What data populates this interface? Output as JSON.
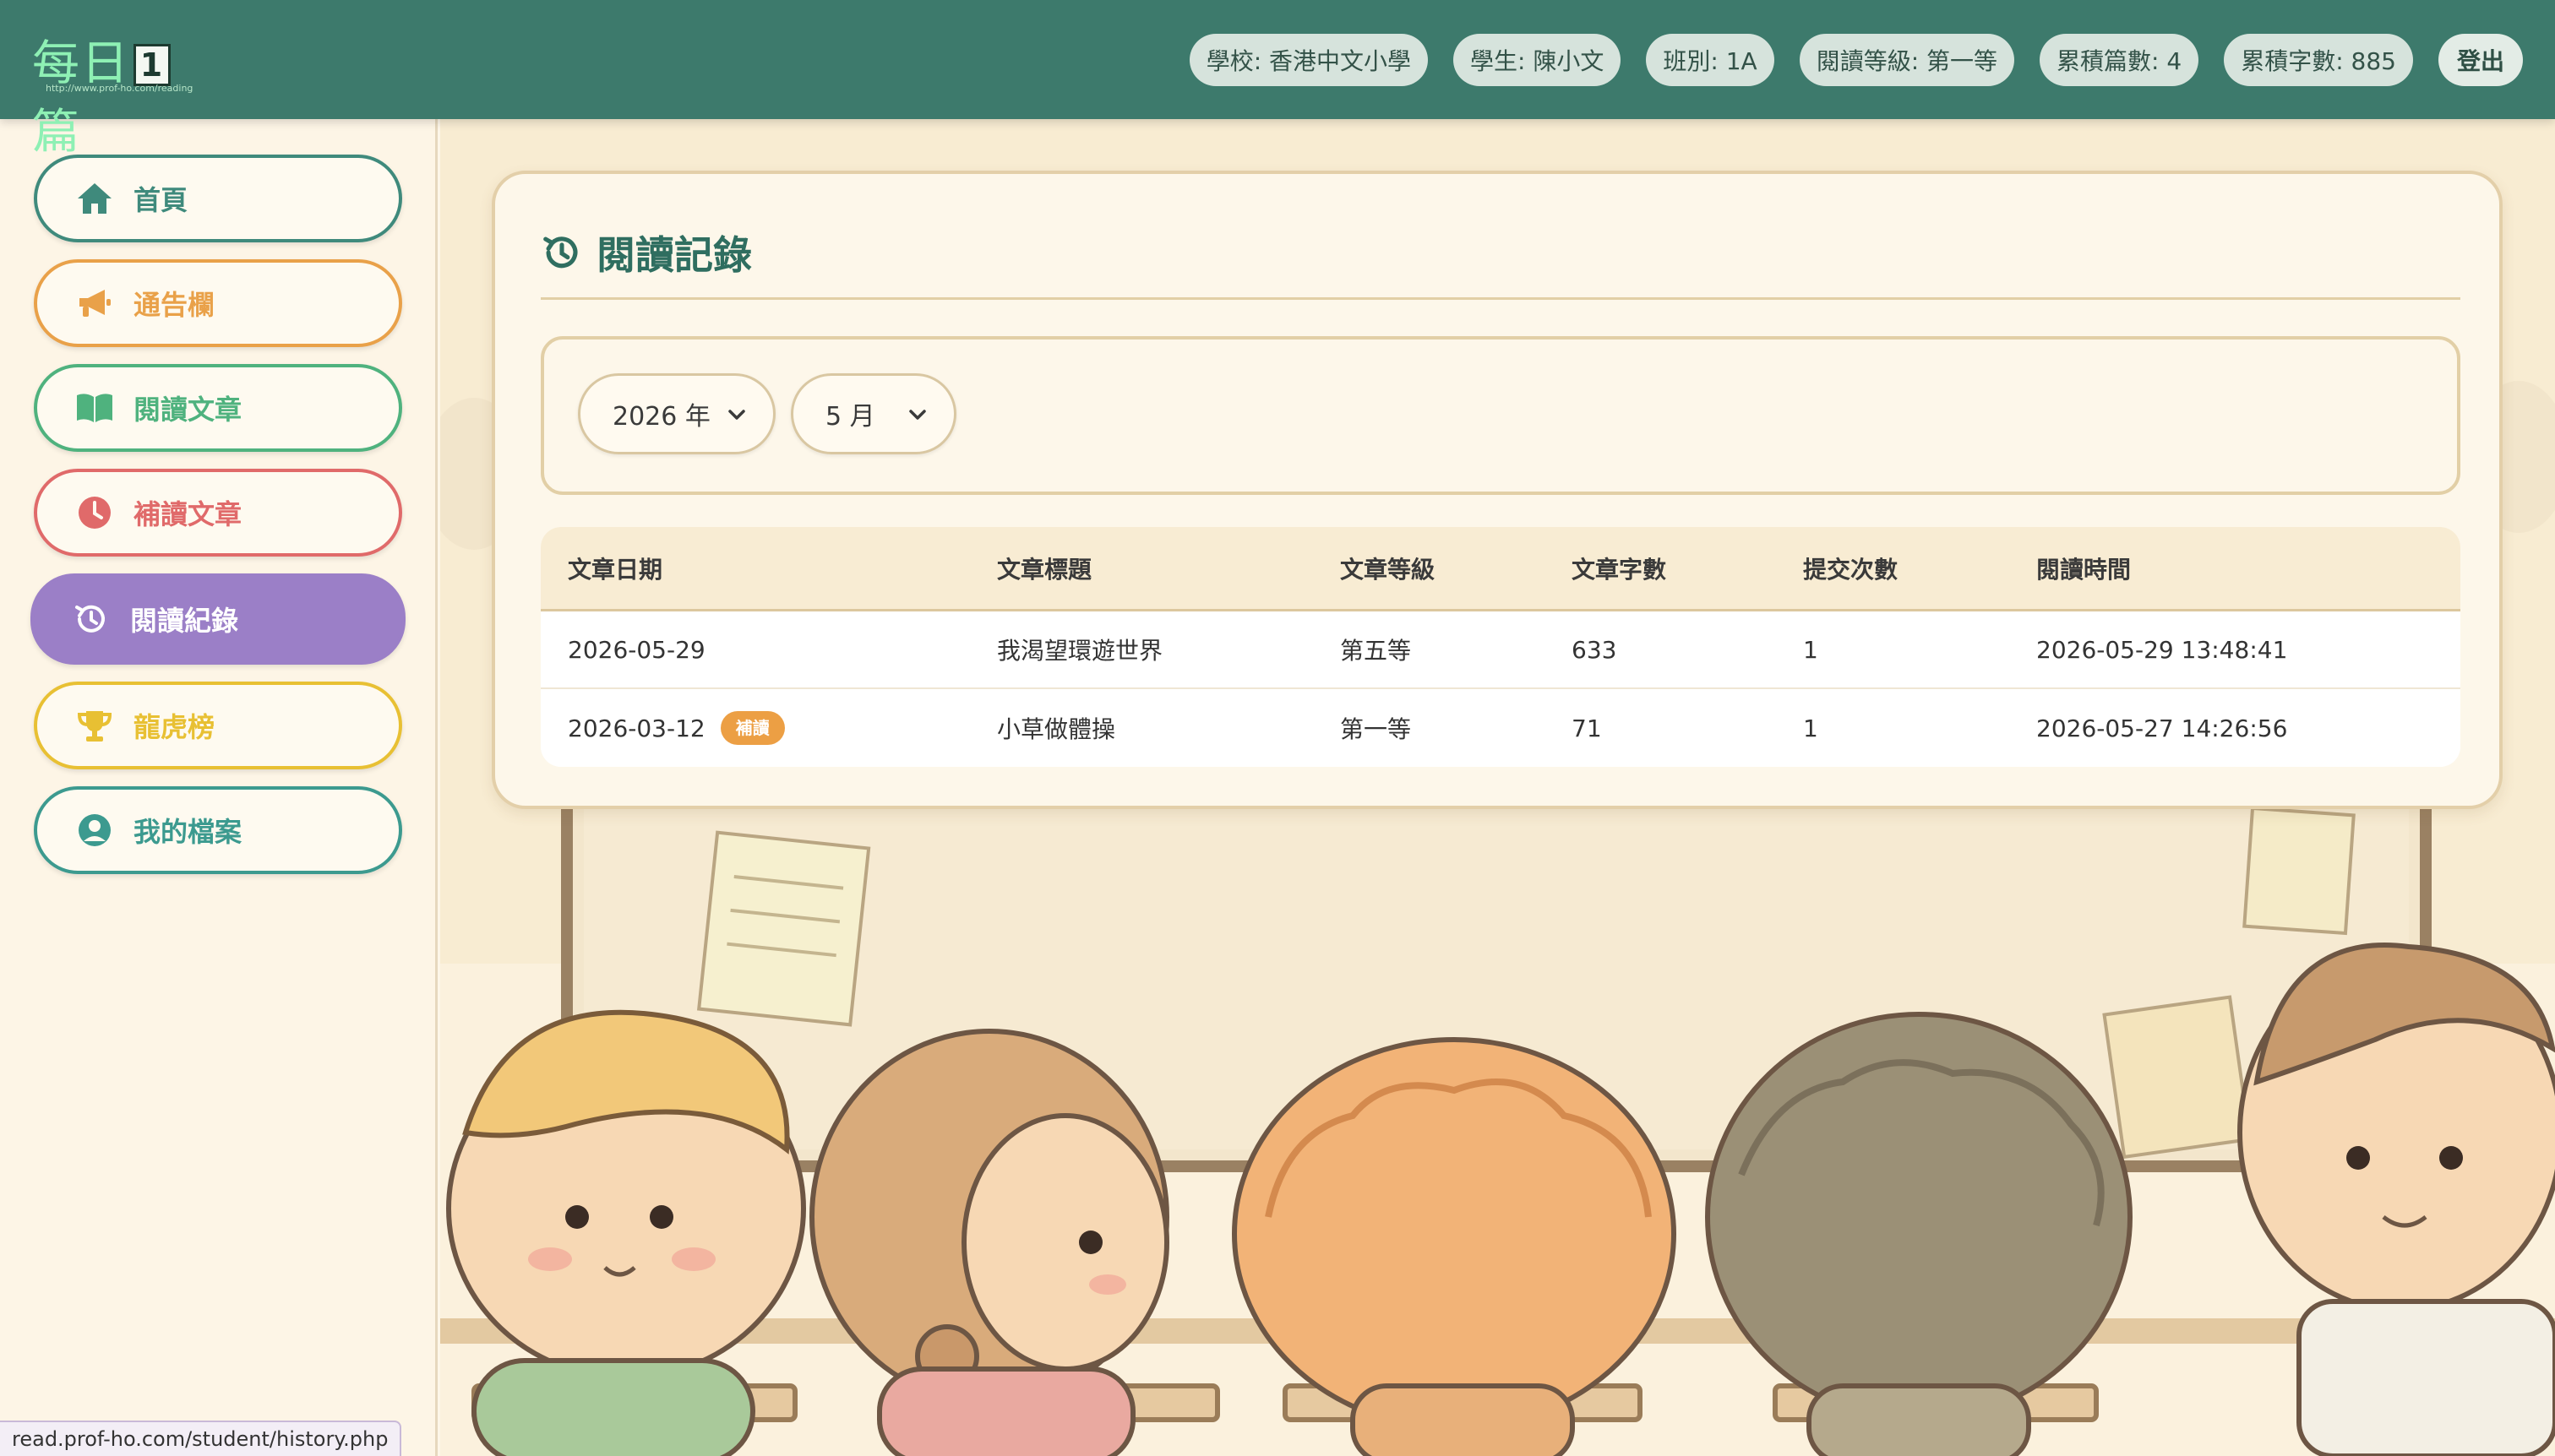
{
  "header": {
    "logo_text_left": "每日",
    "logo_box": "1",
    "logo_text_right": "篇",
    "logo_url": "http://www.prof-ho.com/reading",
    "pills": [
      "學校: 香港中文小學",
      "學生: 陳小文",
      "班別: 1A",
      "閱讀等級: 第一等",
      "累積篇數: 4",
      "累積字數: 885"
    ],
    "logout": "登出"
  },
  "sidebar": {
    "items": [
      {
        "label": "首頁",
        "icon": "home-icon"
      },
      {
        "label": "通告欄",
        "icon": "megaphone-icon"
      },
      {
        "label": "閱讀文章",
        "icon": "book-icon"
      },
      {
        "label": "補讀文章",
        "icon": "clock-icon"
      },
      {
        "label": "閱讀紀錄",
        "icon": "history-icon"
      },
      {
        "label": "龍虎榜",
        "icon": "trophy-icon"
      },
      {
        "label": "我的檔案",
        "icon": "user-circle-icon"
      }
    ],
    "active_index": 4
  },
  "main": {
    "title": "閱讀記錄",
    "filters": {
      "year": "2026 年",
      "month": "5 月"
    },
    "table": {
      "headers": [
        "文章日期",
        "文章標題",
        "文章等級",
        "文章字數",
        "提交次數",
        "閱讀時間"
      ],
      "rows": [
        {
          "date": "2026-05-29",
          "tag": "",
          "title": "我渴望環遊世界",
          "level": "第五等",
          "words": "633",
          "submits": "1",
          "time": "2026-05-29 13:48:41"
        },
        {
          "date": "2026-03-12",
          "tag": "補讀",
          "title": "小草做體操",
          "level": "第一等",
          "words": "71",
          "submits": "1",
          "time": "2026-05-27 14:26:56"
        }
      ]
    }
  },
  "statusbar": {
    "url": "read.prof-ho.com/student/history.php"
  },
  "colors": {
    "header_bg": "#3d7a6c",
    "active_nav": "#9b7fc7",
    "tag_makeup": "#ec9f44",
    "accent_title": "#2f6e60"
  }
}
